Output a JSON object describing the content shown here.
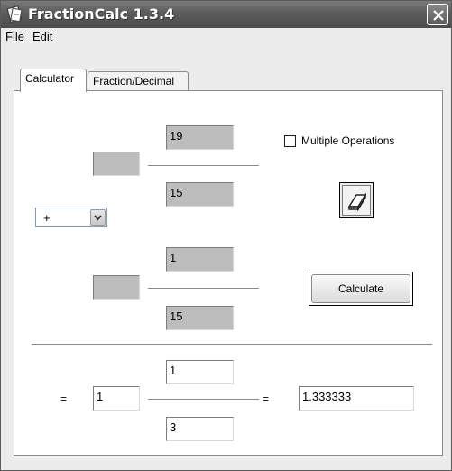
{
  "window": {
    "title": "FractionCalc 1.3.4",
    "app_icon": "fraction-calc-icon",
    "close_icon": "close-icon"
  },
  "menu": {
    "items": [
      "File",
      "Edit"
    ]
  },
  "tabs": [
    {
      "label": "Calculator",
      "active": true
    },
    {
      "label": "Fraction/Decimal",
      "active": false
    }
  ],
  "calculator": {
    "fraction1": {
      "whole": "",
      "numerator": "19",
      "denominator": "15"
    },
    "operator": {
      "selected": "+"
    },
    "fraction2": {
      "whole": "",
      "numerator": "1",
      "denominator": "15"
    },
    "multiple_operations": {
      "label": "Multiple Operations",
      "checked": false
    },
    "clear_icon": "eraser-icon",
    "calculate_label": "Calculate"
  },
  "result": {
    "equals_sign": "=",
    "whole": "1",
    "numerator": "1",
    "denominator": "3",
    "decimal": "1.333333"
  },
  "colors": {
    "titlebar": "#5b5b5b",
    "input_field": "#bdbdbd",
    "window_bg": "#ececec"
  }
}
